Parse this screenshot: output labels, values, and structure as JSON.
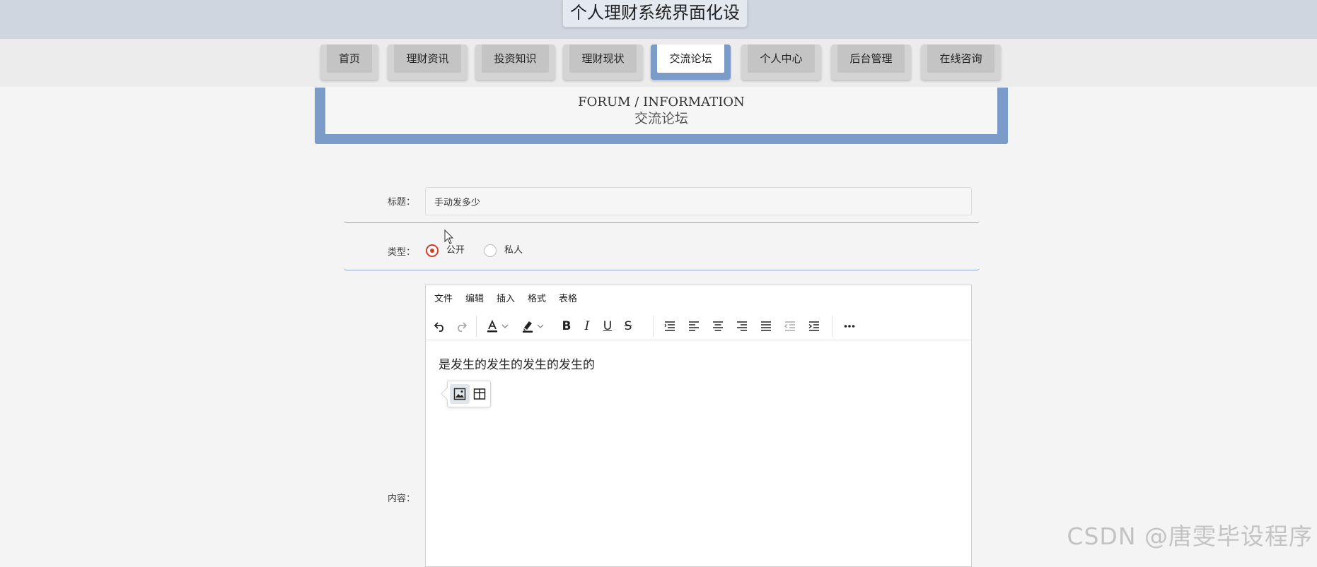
{
  "header": {
    "site_title": "个人理财系统界面化设"
  },
  "nav": {
    "items": [
      {
        "label": "首页",
        "active": false
      },
      {
        "label": "理财资讯",
        "active": false
      },
      {
        "label": "投资知识",
        "active": false
      },
      {
        "label": "理财现状",
        "active": false
      },
      {
        "label": "交流论坛",
        "active": true
      },
      {
        "label": "个人中心",
        "active": false
      },
      {
        "label": "后台管理",
        "active": false
      },
      {
        "label": "在线咨询",
        "active": false
      }
    ]
  },
  "banner": {
    "en": "FORUM / INFORMATION",
    "zh": "交流论坛"
  },
  "form": {
    "title_label": "标题：",
    "title_value": "手动发多少",
    "type_label": "类型：",
    "type_options": [
      "公开",
      "私人"
    ],
    "type_selected": "公开",
    "content_label": "内容："
  },
  "editor": {
    "menu": [
      "文件",
      "编辑",
      "插入",
      "格式",
      "表格"
    ],
    "content": "是发生的发生的发生的发生的",
    "toolbar_icons": [
      "undo-icon",
      "redo-icon",
      "text-color-icon",
      "highlight-icon",
      "bold-icon",
      "italic-icon",
      "underline-icon",
      "strikethrough-icon",
      "line-height-icon",
      "align-left-icon",
      "align-center-icon",
      "align-right-icon",
      "align-justify-icon",
      "outdent-icon",
      "indent-icon",
      "more-icon"
    ],
    "quick_insert_icons": [
      "image-icon",
      "table-icon"
    ]
  },
  "colors": {
    "accent": "#7b9bc9",
    "radio_checked": "#d63c2a",
    "topbar": "#d0d6e0"
  },
  "watermark": "CSDN @唐雯毕设程序"
}
